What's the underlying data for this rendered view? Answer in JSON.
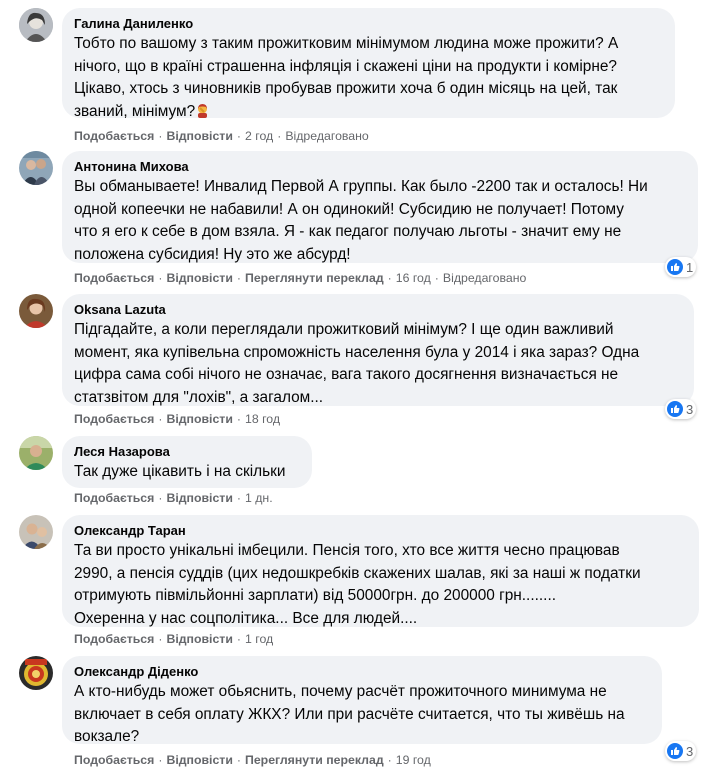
{
  "actions": {
    "like": "Подобається",
    "reply": "Відповісти",
    "translate": "Переглянути переклад",
    "edited": "Відредаговано"
  },
  "comments": [
    {
      "author": "Галина Даниленко",
      "lines": [
        "Тобто по вашому з таким прожитковим мінімумом людина може прожити? А",
        "нічого, що в країні страшенна інфляція і скажені ціни на продукти і комірне?",
        "Цікаво, хтось з чиновників пробував прожити хоча б один місяць на цей, так",
        "званий, мінімум?"
      ],
      "emoji": "person-facepalming-emoji",
      "time": "2 год",
      "edited": true
    },
    {
      "author": "Антонина Михова",
      "lines": [
        "Вы обманываете! Инвалид Первой А группы. Как было -2200 так и осталось! Ни",
        "одной копеечки не набавили! А он одинокий! Субсидию не получает! Потому",
        "что я его к себе в дом взяла. Я - как педагог получаю льготы - значит ему не",
        "положена субсидия! Ну это же абсурд!"
      ],
      "time": "16 год",
      "edited": true,
      "reactions": "1"
    },
    {
      "author": "Oksana Lazuta",
      "lines": [
        "Підгадайте, а коли переглядали прожитковий мінімум? І ще один важливий",
        "момент, яка купівельна спроможність населення була у 2014 і яка зараз? Одна",
        "цифра сама собі нічого не означає, вага такого досягнення визначається не",
        "статзвітом для \"лохів\", а загалом..."
      ],
      "time": "18 год",
      "reactions": "3"
    },
    {
      "author": "Леся Назарова",
      "lines": [
        "Так дуже цікавить і на скільки"
      ],
      "time": "1 дн."
    },
    {
      "author": "Олександр Таран",
      "lines": [
        "Та ви просто унікальні імбецили. Пенсія того, хто все життя чесно працював",
        "2990, а пенсія суддів (цих недошкребків скажених шалав, які за наші ж податки",
        "отримують півмільйонні зарплати) від 50000грн. до 200000 грн........",
        "Охеренна у нас соцполітика... Все для людей...."
      ],
      "time": "1 год"
    },
    {
      "author": "Олександр Діденко",
      "lines": [
        "А кто-нибудь может обьяснить, почему расчёт прожиточного минимума не",
        "включает в себя оплату ЖКХ? Или при расчёте считается, что ты живёшь на",
        "вокзале?"
      ],
      "time": "19 год",
      "reactions": "3"
    }
  ],
  "colors": {
    "bubble": "#f0f2f5",
    "meta": "#65676b",
    "like": "#1877f2"
  }
}
